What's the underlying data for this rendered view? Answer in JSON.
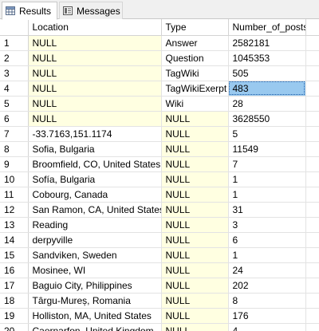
{
  "tabs": [
    {
      "label": "Results",
      "icon": "grid-icon"
    },
    {
      "label": "Messages",
      "icon": "messages-icon"
    }
  ],
  "grid": {
    "columns": [
      "Location",
      "Type",
      "Number_of_posts"
    ],
    "null_color": "#ffffe1",
    "selection_color": "#99c9ef",
    "selected_cell": {
      "row": 4,
      "column": "Number_of_posts"
    },
    "rows": [
      {
        "n": "1",
        "location": "NULL",
        "type": "Answer",
        "posts": "2582181"
      },
      {
        "n": "2",
        "location": "NULL",
        "type": "Question",
        "posts": "1045353"
      },
      {
        "n": "3",
        "location": "NULL",
        "type": "TagWiki",
        "posts": "505"
      },
      {
        "n": "4",
        "location": "NULL",
        "type": "TagWikiExerpt",
        "posts": "483"
      },
      {
        "n": "5",
        "location": "NULL",
        "type": "Wiki",
        "posts": "28"
      },
      {
        "n": "6",
        "location": "NULL",
        "type": "NULL",
        "posts": "3628550"
      },
      {
        "n": "7",
        "location": "-33.7163,151.1174",
        "type": "NULL",
        "posts": "5"
      },
      {
        "n": "8",
        "location": "Sofia, Bulgaria",
        "type": "NULL",
        "posts": "11549"
      },
      {
        "n": "9",
        "location": "Broomfield, CO, United States",
        "type": "NULL",
        "posts": "7"
      },
      {
        "n": "10",
        "location": "Sofía, Bulgaria",
        "type": "NULL",
        "posts": "1"
      },
      {
        "n": "11",
        "location": "Cobourg, Canada",
        "type": "NULL",
        "posts": "1"
      },
      {
        "n": "12",
        "location": "San Ramon, CA, United States",
        "type": "NULL",
        "posts": "31"
      },
      {
        "n": "13",
        "location": "Reading",
        "type": "NULL",
        "posts": "3"
      },
      {
        "n": "14",
        "location": "derpyville",
        "type": "NULL",
        "posts": "6"
      },
      {
        "n": "15",
        "location": "Sandviken, Sweden",
        "type": "NULL",
        "posts": "1"
      },
      {
        "n": "16",
        "location": "Mosinee, WI",
        "type": "NULL",
        "posts": "24"
      },
      {
        "n": "17",
        "location": "Baguio City, Philippines",
        "type": "NULL",
        "posts": "202"
      },
      {
        "n": "18",
        "location": "Târgu-Mureș, Romania",
        "type": "NULL",
        "posts": "8"
      },
      {
        "n": "19",
        "location": "Holliston, MA, United States",
        "type": "NULL",
        "posts": "176"
      },
      {
        "n": "20",
        "location": "Caernarfon, United Kingdom",
        "type": "NULL",
        "posts": "4"
      }
    ]
  }
}
